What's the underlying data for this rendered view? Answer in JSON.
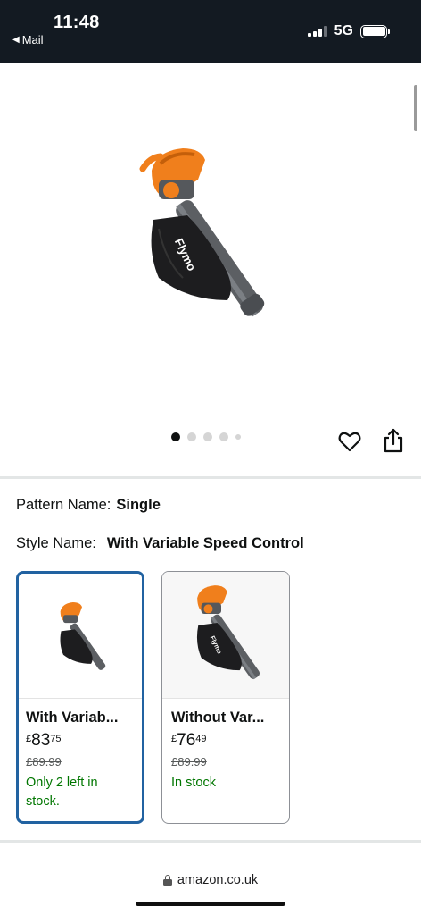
{
  "status_bar": {
    "time": "11:48",
    "back_label": "Mail",
    "network": "5G"
  },
  "gallery": {
    "image_count": 5,
    "active_index": 0,
    "wishlist_icon": "heart-icon",
    "share_icon": "share-icon"
  },
  "variations": {
    "pattern_label": "Pattern Name:",
    "pattern_value": "Single",
    "style_label": "Style Name:",
    "style_value": "With Variable Speed Control",
    "options": [
      {
        "title": "With Variab...",
        "currency": "£",
        "price_whole": "83",
        "price_fraction": "75",
        "rrp": "£89.99",
        "stock": "Only 2 left in stock.",
        "selected": true
      },
      {
        "title": "Without Var...",
        "currency": "£",
        "price_whole": "76",
        "price_fraction": "49",
        "rrp": "£89.99",
        "stock": "In stock",
        "selected": false
      }
    ]
  },
  "browser": {
    "url": "amazon.co.uk"
  },
  "colors": {
    "status_bar_bg": "#131a22",
    "selected_border": "#2162a1",
    "in_stock": "#007600",
    "product_orange": "#f07f1c"
  }
}
